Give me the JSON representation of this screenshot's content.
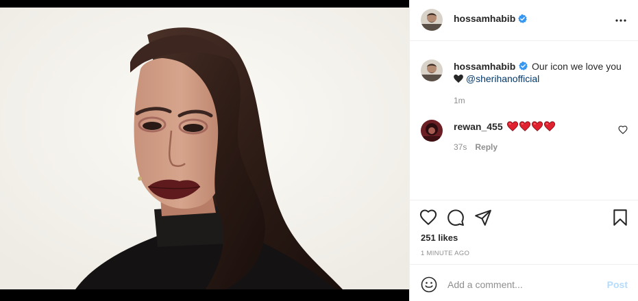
{
  "post": {
    "username": "hossamhabib",
    "verified": true,
    "menu_icon": "more-horizontal-icon",
    "caption": {
      "username": "hossamhabib",
      "text": "Our icon we love you",
      "heart_emoji": "black-heart-icon",
      "mention": "@sherihanofficial",
      "time": "1m"
    },
    "comments": [
      {
        "username": "rewan_455",
        "hearts": [
          "red-heart-icon",
          "red-heart-icon",
          "red-heart-icon",
          "red-heart-icon"
        ],
        "time": "37s",
        "reply_label": "Reply"
      }
    ],
    "likes_text": "251 likes",
    "posted_ago": "1 MINUTE AGO",
    "composer": {
      "placeholder": "Add a comment...",
      "post_label": "Post"
    }
  },
  "colors": {
    "verified_blue": "#3897f0",
    "mention": "#00376b",
    "post_disabled": "#b3dbff",
    "muted": "#8e8e8e",
    "divider": "#efefef"
  }
}
